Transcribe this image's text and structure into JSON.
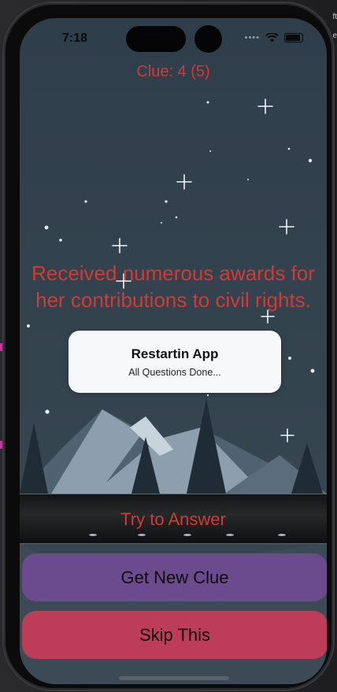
{
  "device": {
    "time": "7:18"
  },
  "ide": {
    "side_text": "ft",
    "side_text2": "e"
  },
  "game": {
    "clue_counter": "Clue: 4 (5)",
    "clue_text": "Received numerous awards for her contributions to civil rights."
  },
  "toast": {
    "title": "Restartin App",
    "message": "All Questions Done..."
  },
  "actions": {
    "try_answer_label": "Try to Answer",
    "new_clue_label": "Get New Clue",
    "skip_label": "Skip This"
  },
  "colors": {
    "clue_text": "#d23a33",
    "new_clue_button": "#6b4a8e",
    "skip_button": "#bd3d58",
    "background": "#34444f"
  },
  "icons": [
    "wifi-icon",
    "battery-icon",
    "cellular-dots-icon",
    "star-icon",
    "mountain-icon",
    "pine-tree-icon"
  ]
}
